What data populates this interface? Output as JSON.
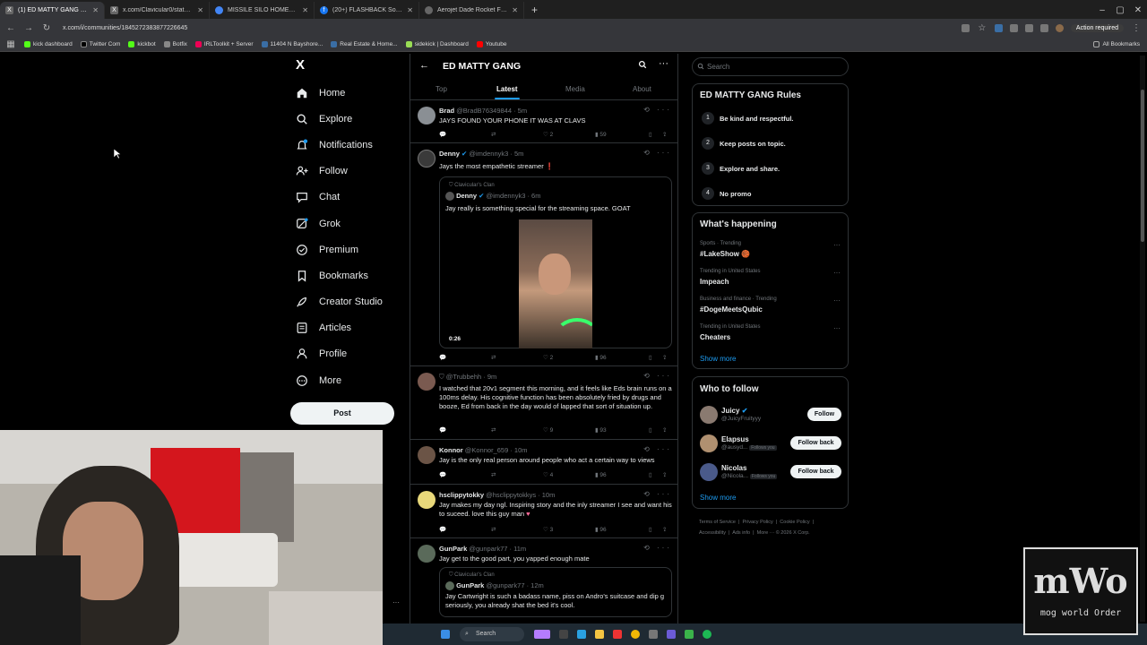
{
  "browser": {
    "tabs": [
      {
        "title": "(1) ED MATTY GANG Community",
        "active": true,
        "icon": "x-icon"
      },
      {
        "title": "x.com/Clavicular0/status/2039",
        "active": false,
        "icon": "x-icon"
      },
      {
        "title": "MISSILE SILO HOMESTEAD - G",
        "active": false,
        "icon": "globe-icon"
      },
      {
        "title": "(20+) FLASHBACK South Florida",
        "active": false,
        "icon": "facebook-icon"
      },
      {
        "title": "Aerojet Dade Rocket Facility | #",
        "active": false,
        "icon": "globe-icon"
      }
    ],
    "new_tab": "+",
    "url": "x.com/i/communities/1845272383877226645",
    "action_required": "Action required",
    "all_bookmarks": "All Bookmarks",
    "bookmarks": [
      "kick dashboard",
      "Twitter Com",
      "kickbot",
      "Botfix",
      "IRLToolkit + Server",
      "11404 N Bayshore...",
      "Real Estate & Home...",
      "sidekick | Dashboard",
      "Youtube"
    ]
  },
  "nav": {
    "logo": "X",
    "items": [
      {
        "label": "Home",
        "icon": "home-icon"
      },
      {
        "label": "Explore",
        "icon": "search-icon"
      },
      {
        "label": "Notifications",
        "icon": "bell-icon"
      },
      {
        "label": "Follow",
        "icon": "follow-icon"
      },
      {
        "label": "Chat",
        "icon": "chat-icon"
      },
      {
        "label": "Grok",
        "icon": "grok-icon"
      },
      {
        "label": "Premium",
        "icon": "premium-icon"
      },
      {
        "label": "Bookmarks",
        "icon": "bookmark-icon"
      },
      {
        "label": "Creator Studio",
        "icon": "rocket-icon"
      },
      {
        "label": "Articles",
        "icon": "articles-icon"
      },
      {
        "label": "Profile",
        "icon": "person-icon"
      },
      {
        "label": "More",
        "icon": "more-icon"
      }
    ],
    "post_button": "Post"
  },
  "community": {
    "title": "ED MATTY GANG",
    "tabs": [
      "Top",
      "Latest",
      "Media",
      "About"
    ],
    "active_tab": "Latest"
  },
  "posts": [
    {
      "name": "Brad",
      "handle": "@BradB76349844 · 5m",
      "text": "JAYS FOUND YOUR PHONE IT WAS AT CLAVS",
      "likes": "2",
      "views": "59"
    },
    {
      "name": "Denny",
      "handle": "@imdennyk3 · 5m",
      "text": "Jays the most empathetic streamer",
      "likes": "2",
      "views": "96",
      "quote": {
        "community": "Clavicular's Clan",
        "name": "Denny",
        "handle": "@imdennyk3 · 6m",
        "text": "Jay really is something special for the streaming space. GOAT",
        "duration": "0:26"
      }
    },
    {
      "name": "",
      "handle": "@Trubbehh · 9m",
      "text": "I watched that 20v1 segment this morning, and it feels like Eds brain runs on a 100ms delay. His cognitive function has been absolutely fried by drugs and booze, Ed from back in the day would of lapped that sort of situation up.",
      "likes": "9",
      "views": "93"
    },
    {
      "name": "Konnor",
      "handle": "@Konnor_659 · 10m",
      "text": "Jay is the only real person around people who act a certain way to views",
      "likes": "4",
      "views": "96"
    },
    {
      "name": "hsclippytokky",
      "handle": "@hsclippytokkys · 10m",
      "text": "Jay makes my day ngl. Inspiring story and the inly streamer I see and want his to suceed. love this guy man",
      "likes": "3",
      "views": "96"
    },
    {
      "name": "GunPark",
      "handle": "@gunpark77 · 11m",
      "text": "Jay get to the good part, you yapped enough mate",
      "likes": "",
      "views": "",
      "quote": {
        "community": "Clavicular's Clan",
        "name": "GunPark",
        "handle": "@gunpark77 · 12m",
        "text": "Jay Cartwright is such a badass name, piss on Andro's suitcase and dip g seriously, you already shat the bed it's cool.",
        "duration": ""
      }
    }
  ],
  "right": {
    "search_placeholder": "Search",
    "rules_title": "ED MATTY GANG Rules",
    "rules": [
      {
        "num": "1",
        "text": "Be kind and respectful."
      },
      {
        "num": "2",
        "text": "Keep posts on topic."
      },
      {
        "num": "3",
        "text": "Explore and share."
      },
      {
        "num": "4",
        "text": "No promo"
      }
    ],
    "happening_title": "What's happening",
    "trends": [
      {
        "context": "Sports · Trending",
        "name": "#LakeShow 🏀"
      },
      {
        "context": "Trending in United States",
        "name": "Impeach"
      },
      {
        "context": "Business and finance · Trending",
        "name": "#DogeMeetsQubic"
      },
      {
        "context": "Trending in United States",
        "name": "Cheaters"
      }
    ],
    "show_more": "Show more",
    "who_title": "Who to follow",
    "who": [
      {
        "name": "Juicy",
        "handle": "@JuicyFruityyy",
        "button": "Follow",
        "follows_you": ""
      },
      {
        "name": "Elapsus",
        "handle": "@ausyd...",
        "button": "Follow back",
        "follows_you": "Follows you"
      },
      {
        "name": "Nicolas",
        "handle": "@Nicola...",
        "button": "Follow back",
        "follows_you": "Follows you"
      }
    ],
    "footer": [
      "Terms of Service",
      "Privacy Policy",
      "Cookie Policy",
      "Accessibility",
      "Ads info",
      "More ···",
      "© 2026 X Corp."
    ]
  },
  "taskbar": {
    "search": "Search"
  },
  "overlay": {
    "logo_big": "mWo",
    "logo_small": "mog world Order"
  },
  "colors": {
    "accent": "#1d9bf0",
    "background": "#000000",
    "border": "#2f3336",
    "muted": "#71767b"
  }
}
